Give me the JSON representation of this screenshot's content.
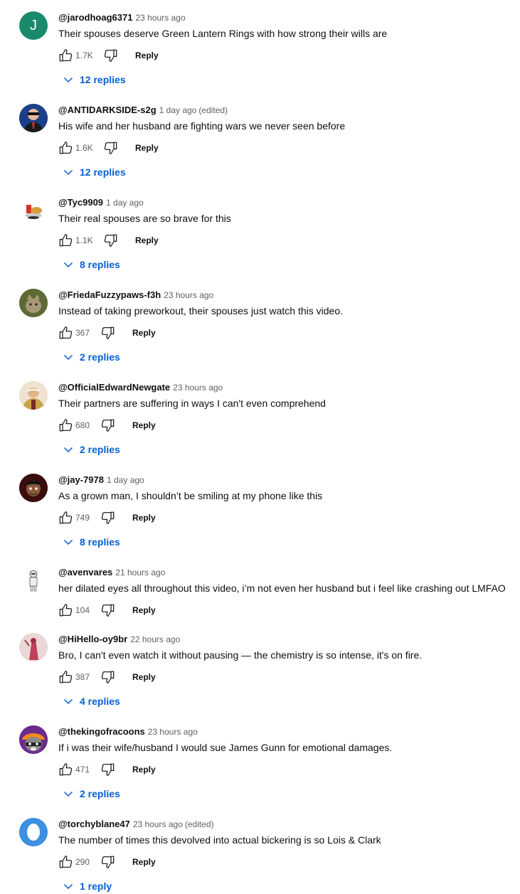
{
  "labels": {
    "reply": "Reply"
  },
  "colors": {
    "accent": "#065fd4",
    "secondary_text": "#606060",
    "primary_text": "#0f0f0f"
  },
  "comments": [
    {
      "author": "@jarodhoag6371",
      "time": "23 hours ago",
      "edited": "",
      "text": "Their spouses deserve Green Lantern Rings with how strong their wills are",
      "likes": "1.7K",
      "replies": "12 replies",
      "avatar": {
        "type": "letter",
        "letter": "J",
        "color": "#1a8a6d"
      }
    },
    {
      "author": "@ANTIDARKSIDE-s2g",
      "time": "1 day ago",
      "edited": "(edited)",
      "text": "His wife and her husband are fighting wars we never seen before",
      "likes": "1.6K",
      "replies": "12 replies",
      "avatar": {
        "type": "photo-man-sunglasses"
      }
    },
    {
      "author": "@Tyc9909",
      "time": "1 day ago",
      "edited": "",
      "text": "Their real spouses are so brave for this",
      "likes": "1.1K",
      "replies": "8 replies",
      "avatar": {
        "type": "photo-food"
      }
    },
    {
      "author": "@FriedaFuzzypaws-f3h",
      "time": "23 hours ago",
      "edited": "",
      "text": "Instead of taking preworkout, their spouses just watch this video.",
      "likes": "367",
      "replies": "2 replies",
      "avatar": {
        "type": "photo-cat"
      }
    },
    {
      "author": "@OfficialEdwardNewgate",
      "time": "23 hours ago",
      "edited": "",
      "text": "Their partners are suffering in ways I can't even comprehend",
      "likes": "680",
      "replies": "2 replies",
      "avatar": {
        "type": "photo-anime-whitebeard"
      }
    },
    {
      "author": "@jay-7978",
      "time": "1 day ago",
      "edited": "",
      "text": "As a grown man, I shouldn’t be smiling at my phone like this",
      "likes": "749",
      "replies": "8 replies",
      "avatar": {
        "type": "photo-cartoon-boy"
      }
    },
    {
      "author": "@avenvares",
      "time": "21 hours ago",
      "edited": "",
      "text": "her dilated eyes all throughout this video, i’m not even her husband but i feel like crashing out LMFAO",
      "likes": "104",
      "replies": "",
      "avatar": {
        "type": "photo-stormtrooper"
      }
    },
    {
      "author": "@HiHello-oy9br",
      "time": "22 hours ago",
      "edited": "",
      "text": "Bro, I can't even watch it without pausing — the chemistry is so intense, it's on fire.",
      "likes": "387",
      "replies": "4 replies",
      "avatar": {
        "type": "photo-pink-figure"
      }
    },
    {
      "author": "@thekingofracoons",
      "time": "23 hours ago",
      "edited": "",
      "text": "If i was their wife/husband I would sue James Gunn for emotional damages.",
      "likes": "471",
      "replies": "2 replies",
      "avatar": {
        "type": "photo-raccoon"
      }
    },
    {
      "author": "@torchyblane47",
      "time": "23 hours ago",
      "edited": "(edited)",
      "text": "The number of times this devolved into actual bickering is so Lois & Clark",
      "likes": "290",
      "replies": "1 reply",
      "avatar": {
        "type": "photo-egg"
      }
    }
  ]
}
